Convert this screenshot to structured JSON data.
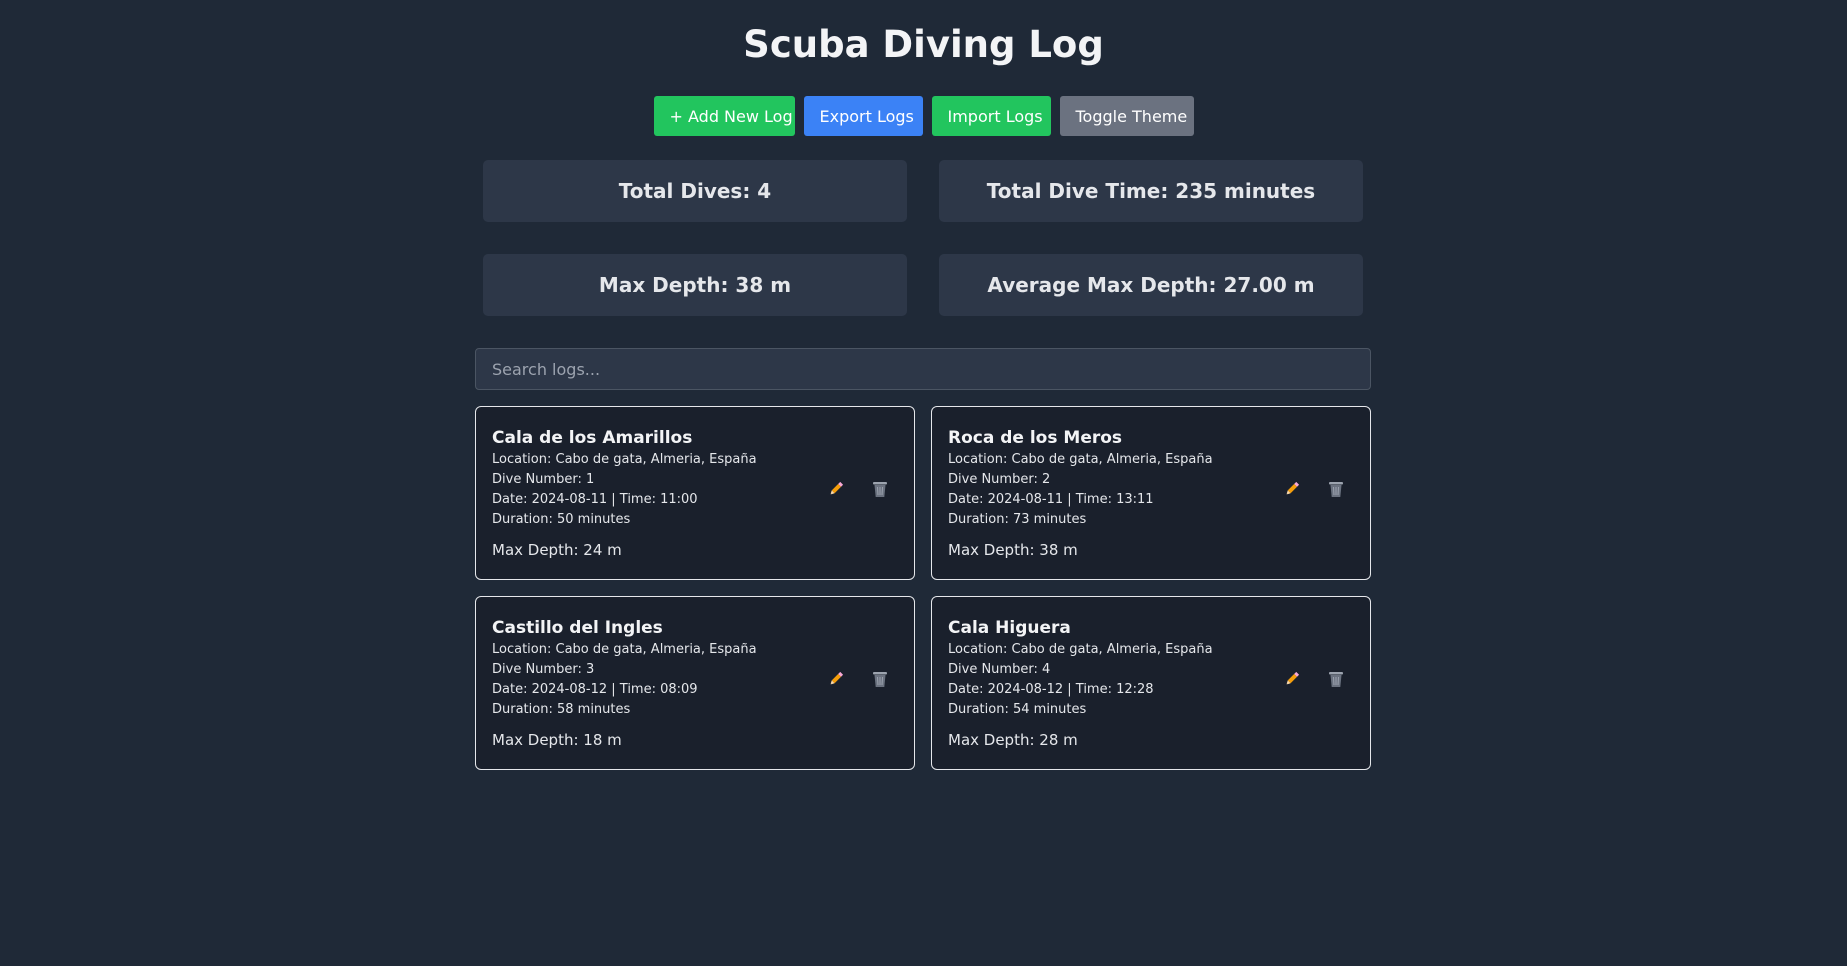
{
  "title": "Scuba Diving Log",
  "toolbar": {
    "add_label": "+ Add New Log",
    "export_label": "Export Logs",
    "import_label": "Import Logs",
    "theme_label": "Toggle Theme"
  },
  "stats": {
    "total_dives": "Total Dives: 4",
    "total_time": "Total Dive Time: 235 minutes",
    "max_depth": "Max Depth: 38 m",
    "avg_max_depth": "Average Max Depth: 27.00 m"
  },
  "search": {
    "placeholder": "Search logs..."
  },
  "logs": [
    {
      "name": "Cala de los Amarillos",
      "location": "Location: Cabo de gata, Almeria, España",
      "dive_number": "Dive Number: 1",
      "date_time": "Date: 2024-08-11 | Time: 11:00",
      "duration": "Duration: 50 minutes",
      "max_depth": "Max Depth: 24 m"
    },
    {
      "name": "Roca de los Meros",
      "location": "Location: Cabo de gata, Almeria, España",
      "dive_number": "Dive Number: 2",
      "date_time": "Date: 2024-08-11 | Time: 13:11",
      "duration": "Duration: 73 minutes",
      "max_depth": "Max Depth: 38 m"
    },
    {
      "name": "Castillo del Ingles",
      "location": "Location: Cabo de gata, Almeria, España",
      "dive_number": "Dive Number: 3",
      "date_time": "Date: 2024-08-12 | Time: 08:09",
      "duration": "Duration: 58 minutes",
      "max_depth": "Max Depth: 18 m"
    },
    {
      "name": "Cala Higuera",
      "location": "Location: Cabo de gata, Almeria, España",
      "dive_number": "Dive Number: 4",
      "date_time": "Date: 2024-08-12 | Time: 12:28",
      "duration": "Duration: 54 minutes",
      "max_depth": "Max Depth: 28 m"
    }
  ],
  "icons": {
    "edit": "pencil-icon",
    "delete": "trash-icon"
  },
  "colors": {
    "background": "#1f2937",
    "add_button": "#22c55e",
    "export_button": "#3b82f6",
    "import_button": "#22c55e",
    "theme_button": "#6b7280"
  }
}
